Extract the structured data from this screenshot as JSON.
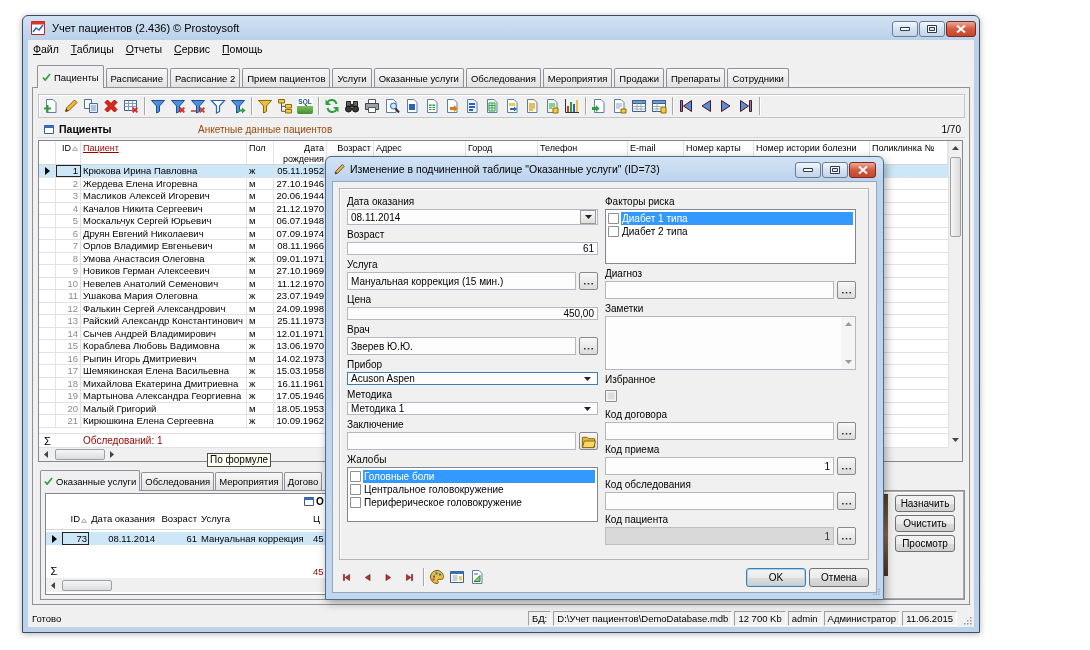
{
  "window": {
    "title": "Учет пациентов (2.436) © Prostoysoft"
  },
  "menu": [
    "Файл",
    "Таблицы",
    "Отчеты",
    "Сервис",
    "Помощь"
  ],
  "tabs": [
    {
      "label": "Пациенты",
      "selected": true
    },
    {
      "label": "Расписание",
      "selected": false
    },
    {
      "label": "Расписание 2",
      "selected": false
    },
    {
      "label": "Прием пациентов",
      "selected": false
    },
    {
      "label": "Услуги",
      "selected": false
    },
    {
      "label": "Оказанные услуги",
      "selected": false
    },
    {
      "label": "Обследования",
      "selected": false
    },
    {
      "label": "Мероприятия",
      "selected": false
    },
    {
      "label": "Продажи",
      "selected": false
    },
    {
      "label": "Препараты",
      "selected": false
    },
    {
      "label": "Сотрудники",
      "selected": false
    }
  ],
  "toolbar": {
    "sql_label": "SQL"
  },
  "patients": {
    "title": "Пациенты",
    "subtitle": "Анкетные данные пациентов",
    "counter": "1/70",
    "columns": [
      {
        "label": "ID",
        "sorted": true,
        "selected": false
      },
      {
        "label": "Пациент",
        "sorted": false,
        "selected": true
      },
      {
        "label": "Пол",
        "sorted": false,
        "selected": false
      },
      {
        "label": "Дата рождения",
        "sorted": false,
        "selected": false
      },
      {
        "label": "Возраст",
        "sorted": false,
        "selected": false
      },
      {
        "label": "Адрес",
        "sorted": false,
        "selected": false
      },
      {
        "label": "Город",
        "sorted": false,
        "selected": false
      },
      {
        "label": "Телефон",
        "sorted": false,
        "selected": false
      },
      {
        "label": "E-mail",
        "sorted": false,
        "selected": false
      },
      {
        "label": "Номер карты",
        "sorted": false,
        "selected": false
      },
      {
        "label": "Номер истории болезни",
        "sorted": false,
        "selected": false
      },
      {
        "label": "Поликлинка №",
        "sorted": false,
        "selected": false
      }
    ],
    "rows": [
      {
        "id": "1",
        "name": "Крюкова Ирина Павловна",
        "sex": "ж",
        "birth_date": "05.11.1952",
        "selected": true
      },
      {
        "id": "2",
        "name": "Жердева Елена Игоревна",
        "sex": "м",
        "birth_date": "27.10.1946",
        "selected": false
      },
      {
        "id": "3",
        "name": "Масликов Алексей Игоревич",
        "sex": "м",
        "birth_date": "20.06.1944",
        "selected": false
      },
      {
        "id": "4",
        "name": "Качалов Никита Сергеевич",
        "sex": "м",
        "birth_date": "21.12.1970",
        "selected": false
      },
      {
        "id": "5",
        "name": "Москальчук Сергей Юрьевич",
        "sex": "м",
        "birth_date": "06.07.1948",
        "selected": false
      },
      {
        "id": "6",
        "name": "Друян Евгений Николаевич",
        "sex": "м",
        "birth_date": "07.09.1974",
        "selected": false
      },
      {
        "id": "7",
        "name": "Орлов Владимир Евгеньевич",
        "sex": "м",
        "birth_date": "08.11.1966",
        "selected": false
      },
      {
        "id": "8",
        "name": "Умова Анастасия Олеговна",
        "sex": "ж",
        "birth_date": "09.01.1971",
        "selected": false
      },
      {
        "id": "9",
        "name": "Новиков Герман Алексеевич",
        "sex": "м",
        "birth_date": "27.10.1969",
        "selected": false
      },
      {
        "id": "10",
        "name": "Невелев Анатолий Семенович",
        "sex": "м",
        "birth_date": "11.12.1970",
        "selected": false
      },
      {
        "id": "11",
        "name": "Ушакова Мария Олеговна",
        "sex": "ж",
        "birth_date": "23.07.1949",
        "selected": false
      },
      {
        "id": "12",
        "name": "Фалькин Сергей Александрович",
        "sex": "м",
        "birth_date": "24.09.1998",
        "selected": false
      },
      {
        "id": "13",
        "name": "Райский Александр Константинович",
        "sex": "м",
        "birth_date": "25.11.1973",
        "selected": false
      },
      {
        "id": "14",
        "name": "Сычев Андрей Владимирович",
        "sex": "м",
        "birth_date": "12.01.1971",
        "selected": false
      },
      {
        "id": "15",
        "name": "Кораблева Любовь Вадимовна",
        "sex": "ж",
        "birth_date": "13.06.1970",
        "selected": false
      },
      {
        "id": "16",
        "name": "Рыпин Игорь Дмитриевич",
        "sex": "м",
        "birth_date": "14.02.1973",
        "selected": false
      },
      {
        "id": "17",
        "name": "Шемякинская Елена Васильевна",
        "sex": "ж",
        "birth_date": "15.03.1958",
        "selected": false
      },
      {
        "id": "18",
        "name": "Михайлова Екатерина Дмитриевна",
        "sex": "ж",
        "birth_date": "16.11.1961",
        "selected": false
      },
      {
        "id": "19",
        "name": "Мартынова Александра Георгиевна",
        "sex": "ж",
        "birth_date": "17.05.1946",
        "selected": false
      },
      {
        "id": "20",
        "name": "Малый Григорий",
        "sex": "м",
        "birth_date": "18.05.1953",
        "selected": false
      },
      {
        "id": "21",
        "name": "Кирюшкина Елена Сергеевна",
        "sex": "ж",
        "birth_date": "10.09.1962",
        "selected": false
      }
    ],
    "sum_sign": "Σ",
    "summary": "Обследований: 1",
    "tooltip": "По формуле"
  },
  "detail_tabs": [
    {
      "label": "Оказанные услуги",
      "selected": true
    },
    {
      "label": "Обследования",
      "selected": false
    },
    {
      "label": "Мероприятия",
      "selected": false
    },
    {
      "label": "Догово",
      "selected": false
    }
  ],
  "services": {
    "title": "О",
    "columns": [
      {
        "label": "ID",
        "sorted": true
      },
      {
        "label": "Дата оказания",
        "sorted": false
      },
      {
        "label": "Возраст",
        "sorted": false
      },
      {
        "label": "Услуга",
        "sorted": false
      },
      {
        "label": "Ц",
        "sorted": false
      }
    ],
    "rows": [
      {
        "cells": [
          "73",
          "08.11.2014",
          "61",
          "Мануальная коррекция",
          "45"
        ],
        "selected": true
      }
    ],
    "sum_sign": "Σ",
    "totals": "45"
  },
  "side_buttons": [
    "Назначить",
    "Очистить",
    "Просмотр"
  ],
  "dialog": {
    "title": "Изменение в подчиненной таблице \"Оказанные услуги\" (ID=73)",
    "left_fields": [
      {
        "label": "Дата оказания",
        "kind": "date",
        "value": "08.11.2014",
        "focused": false,
        "disabled": false
      },
      {
        "label": "Возраст",
        "kind": "number",
        "value": "61",
        "focused": false,
        "disabled": false
      },
      {
        "label": "Услуга",
        "kind": "lookup",
        "value": "Мануальная коррекция (15 мин.)",
        "focused": false,
        "disabled": false
      },
      {
        "label": "Цена",
        "kind": "number",
        "value": "450,00",
        "focused": false,
        "disabled": false
      },
      {
        "label": "Врач",
        "kind": "lookup",
        "value": "Зверев Ю.Ю.",
        "focused": false,
        "disabled": false
      },
      {
        "label": "Прибор",
        "kind": "combo",
        "value": "Acuson Aspen",
        "focused": true,
        "disabled": false
      },
      {
        "label": "Методика",
        "kind": "combo",
        "value": "Методика 1",
        "focused": false,
        "disabled": false
      },
      {
        "label": "Заключение",
        "kind": "file",
        "focused": false,
        "disabled": false
      },
      {
        "label": "Жалобы",
        "kind": "checklist",
        "focused": false,
        "disabled": false,
        "items": [
          {
            "label": "Головные боли",
            "checked": false,
            "selected": true
          },
          {
            "label": "Центральное головокружение",
            "checked": false,
            "selected": false
          },
          {
            "label": "Периферическое головокружение",
            "checked": false,
            "selected": false
          }
        ]
      }
    ],
    "right_fields": [
      {
        "label": "Факторы риска",
        "kind": "checklist",
        "focused": false,
        "disabled": false,
        "items": [
          {
            "label": "Диабет 1 типа",
            "checked": false,
            "selected": true
          },
          {
            "label": "Диабет 2 типа",
            "checked": false,
            "selected": false
          }
        ]
      },
      {
        "label": "Диагноз",
        "kind": "lookup",
        "focused": false,
        "disabled": false
      },
      {
        "label": "Заметки",
        "kind": "memo",
        "focused": false,
        "disabled": false
      },
      {
        "label": "Избранное",
        "kind": "checkbox",
        "checked": false,
        "focused": false,
        "disabled": false
      },
      {
        "label": "Код договора",
        "kind": "code",
        "focused": false,
        "disabled": false
      },
      {
        "label": "Код приема",
        "kind": "code",
        "value": "1",
        "focused": false,
        "disabled": false
      },
      {
        "label": "Код обследования",
        "kind": "code",
        "focused": false,
        "disabled": false
      },
      {
        "label": "Код пациента",
        "kind": "code",
        "value": "1",
        "focused": false,
        "disabled": true
      }
    ],
    "buttons": [
      {
        "label": "OK",
        "default": true
      },
      {
        "label": "Отмена",
        "default": false
      }
    ]
  },
  "status_bar": {
    "message": "Готово",
    "panels": [
      "БД:",
      "D:\\Учет пациентов\\DemoDatabase.mdb",
      "12 700 Kb",
      "admin",
      "Администратор",
      "11.06.2015"
    ]
  }
}
